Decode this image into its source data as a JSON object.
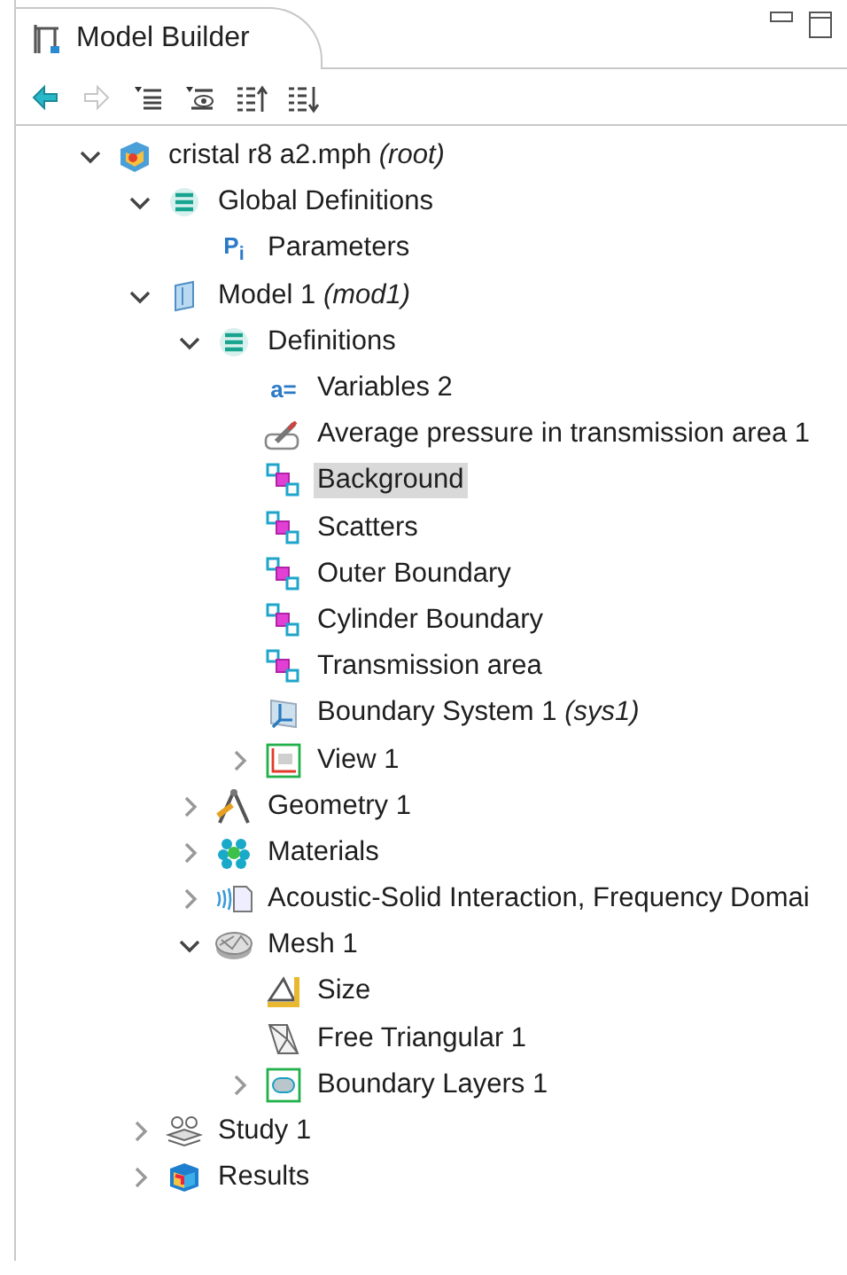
{
  "panel": {
    "title": "Model Builder"
  },
  "toolbar": [
    {
      "kind": "back",
      "disabled": false
    },
    {
      "kind": "forward",
      "disabled": true
    },
    {
      "kind": "expand",
      "disabled": false
    },
    {
      "kind": "show",
      "disabled": false
    },
    {
      "kind": "up",
      "disabled": false
    },
    {
      "kind": "down",
      "disabled": false
    }
  ],
  "tree": [
    {
      "label": "cristal r8 a2.mph",
      "tag": "(root)",
      "kind": "file",
      "expanded": true,
      "selected": false,
      "children": [
        {
          "label": "Global Definitions",
          "kind": "list",
          "expanded": true,
          "selected": false,
          "children": [
            {
              "label": "Parameters",
              "kind": "glyph",
              "icon_text": "P$_{i}$",
              "selected": false
            }
          ]
        },
        {
          "label": "Model 1",
          "tag": "(mod1)",
          "kind": "model",
          "expanded": true,
          "selected": false,
          "children": [
            {
              "label": "Definitions",
              "kind": "list",
              "expanded": true,
              "selected": false,
              "children": [
                {
                  "label": "Variables 2",
                  "kind": "glyph",
                  "icon_text": "a=",
                  "selected": false
                },
                {
                  "label": "Average pressure in transmission area 1",
                  "kind": "probe",
                  "selected": false
                },
                {
                  "label": "Background",
                  "kind": "selection",
                  "selected": true
                },
                {
                  "label": "Scatters",
                  "kind": "selection",
                  "selected": false
                },
                {
                  "label": "Outer Boundary",
                  "kind": "selection",
                  "selected": false
                },
                {
                  "label": "Cylinder Boundary",
                  "kind": "selection",
                  "selected": false
                },
                {
                  "label": "Transmission area",
                  "kind": "selection",
                  "selected": false
                },
                {
                  "label": "Boundary System 1",
                  "tag": "(sys1)",
                  "kind": "coord",
                  "selected": false
                },
                {
                  "label": "View 1",
                  "kind": "view",
                  "expanded": false,
                  "selected": false
                }
              ]
            },
            {
              "label": "Geometry 1",
              "kind": "geometry",
              "expanded": false,
              "selected": false
            },
            {
              "label": "Materials",
              "kind": "materials",
              "expanded": false,
              "selected": false
            },
            {
              "label": "Acoustic-Solid Interaction, Frequency Domai",
              "kind": "physics",
              "expanded": false,
              "selected": false
            },
            {
              "label": "Mesh 1",
              "kind": "mesh",
              "expanded": true,
              "selected": false,
              "children": [
                {
                  "label": "Size",
                  "kind": "size",
                  "selected": false
                },
                {
                  "label": "Free Triangular 1",
                  "kind": "freetri",
                  "selected": false
                },
                {
                  "label": "Boundary Layers 1",
                  "kind": "layers",
                  "expanded": false,
                  "selected": false
                }
              ]
            }
          ]
        },
        {
          "label": "Study 1",
          "kind": "study",
          "expanded": false,
          "selected": false
        },
        {
          "label": "Results",
          "kind": "results",
          "expanded": false,
          "selected": false
        }
      ]
    }
  ]
}
